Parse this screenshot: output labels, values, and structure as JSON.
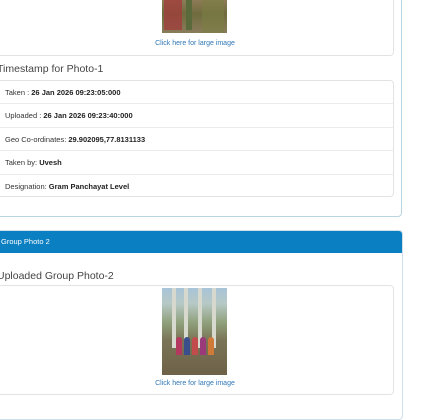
{
  "group_photo_1": {
    "large_image_link": "Click here for large image",
    "timestamp_title": "Timestamp for Photo-1",
    "details": [
      {
        "label": "Taken : ",
        "value": "26 Jan 2026 09:23:05:000"
      },
      {
        "label": "Uploaded : ",
        "value": "26 Jan 2026 09:23:40:000"
      },
      {
        "label": "Geo Co-ordinates: ",
        "value": "29.902095,77.8131133"
      },
      {
        "label": "Taken by: ",
        "value": "Uvesh"
      },
      {
        "label": "Designation: ",
        "value": "Gram Panchayat Level"
      }
    ]
  },
  "group_photo_2": {
    "header": "Group Photo 2",
    "title": "Uploaded Group Photo-2",
    "large_image_link": "Click here for large image"
  }
}
